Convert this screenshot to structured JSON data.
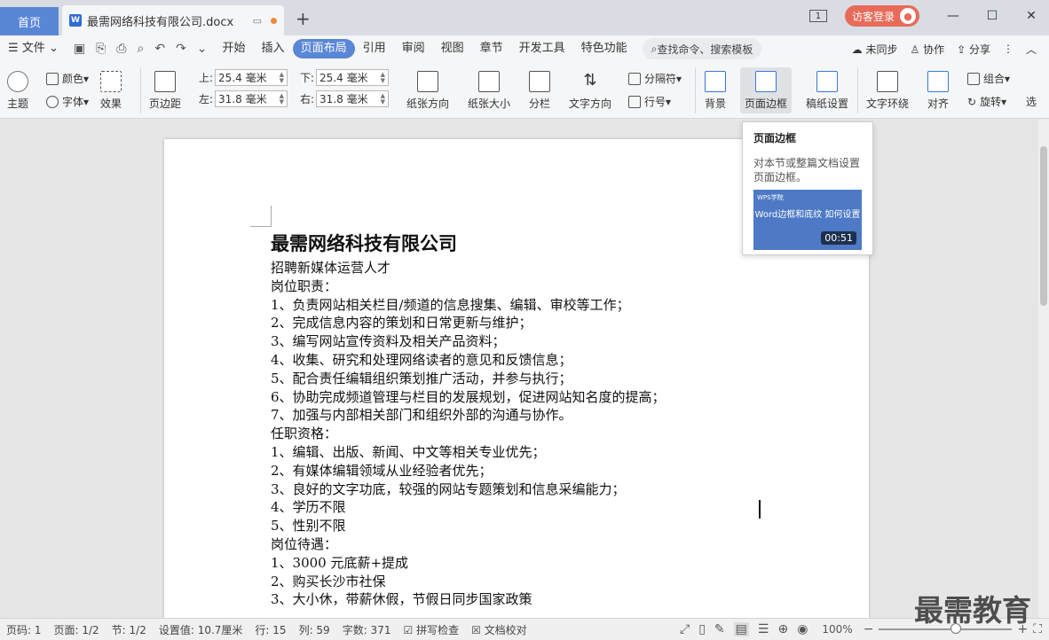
{
  "tabs": {
    "home": "首页",
    "doc": "最需网络科技有限公司.docx"
  },
  "titlebar": {
    "count": "1",
    "visitor": "访客登录",
    "minimize": "—",
    "maximize": "☐",
    "close": "✕"
  },
  "menu": {
    "file": "文件",
    "items": [
      "开始",
      "插入",
      "页面布局",
      "引用",
      "审阅",
      "视图",
      "章节",
      "开发工具",
      "特色功能"
    ],
    "search": "查找命令、搜索模板",
    "sync": "未同步",
    "collab": "协作",
    "share": "分享"
  },
  "toolbar": {
    "theme": "主题",
    "color": "颜色",
    "font": "字体",
    "effect": "效果",
    "margin": "页边距",
    "top_label": "上:",
    "top_val": "25.4 毫米",
    "bottom_label": "下:",
    "bottom_val": "25.4 毫米",
    "left_label": "左:",
    "left_val": "31.8 毫米",
    "right_label": "右:",
    "right_val": "31.8 毫米",
    "orientation": "纸张方向",
    "size": "纸张大小",
    "columns": "分栏",
    "textdir": "文字方向",
    "separator": "分隔符",
    "lineno": "行号",
    "background": "背景",
    "border": "页面边框",
    "draft": "稿纸设置",
    "wrap": "文字环绕",
    "align": "对齐",
    "group": "组合",
    "rotate": "旋转",
    "select": "选"
  },
  "tooltip": {
    "title": "页面边框",
    "desc": "对本节或整篇文档设置页面边框。",
    "video_brand": "WPS学院",
    "video_title": "Word边框和底纹 如何设置",
    "duration": "00:51"
  },
  "document": {
    "heading": "最需网络科技有限公司",
    "lines": [
      "招聘新媒体运营人才",
      "岗位职责：",
      "1、负责网站相关栏目/频道的信息搜集、编辑、审校等工作；",
      "2、完成信息内容的策划和日常更新与维护；",
      "3、编写网站宣传资料及相关产品资料；",
      "4、收集、研究和处理网络读者的意见和反馈信息；",
      "5、配合责任编辑组织策划推广活动，并参与执行；",
      "6、协助完成频道管理与栏目的发展规划，促进网站知名度的提高；",
      "7、加强与内部相关部门和组织外部的沟通与协作。",
      "任职资格：",
      "1、编辑、出版、新闻、中文等相关专业优先；",
      "2、有媒体编辑领域从业经验者优先；",
      "3、良好的文字功底，较强的网站专题策划和信息采编能力；",
      "4、学历不限",
      "5、性别不限",
      "岗位待遇：",
      "1、3000 元底薪+提成",
      "2、购买长沙市社保",
      "3、大小休，带薪休假，节假日同步国家政策"
    ]
  },
  "status": {
    "page": "页码: 1",
    "pages": "页面: 1/2",
    "section": "节: 1/2",
    "setting": "设置值: 10.7厘米",
    "row": "行: 15",
    "col": "列: 59",
    "words": "字数: 371",
    "spell": "拼写检查",
    "proof": "文档校对",
    "zoom": "100%",
    "zoom_level": 0.58
  },
  "watermark": "最需教育"
}
